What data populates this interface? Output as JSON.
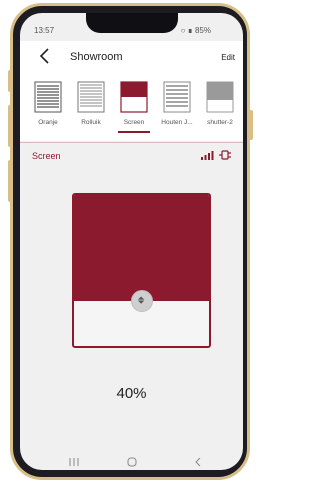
{
  "status": {
    "time": "13:57",
    "battery": "85%"
  },
  "header": {
    "title": "Showroom",
    "edit_label": "Edit"
  },
  "tabs": [
    {
      "label": "Oranje",
      "icon": "horizontal-blinds-icon",
      "active": false
    },
    {
      "label": "Rolluik",
      "icon": "roller-shutter-icon",
      "active": false
    },
    {
      "label": "Screen",
      "icon": "screen-shade-icon",
      "active": true
    },
    {
      "label": "Houten J...",
      "icon": "wooden-blinds-icon",
      "active": false
    },
    {
      "label": "shutter-2",
      "icon": "shutter-icon",
      "active": false
    }
  ],
  "device": {
    "name": "Screen",
    "signal_icon": "signal-bars-icon",
    "power_icon": "plug-icon"
  },
  "shade": {
    "position_percent": 40,
    "position_label": "40%",
    "handle_icon": "up-down-arrows-icon"
  },
  "colors": {
    "accent": "#8b1a2f",
    "background": "#f1f0f0",
    "frame_gold": "#d8bf87"
  },
  "navbar": {
    "items": [
      "recents-icon",
      "home-icon",
      "back-icon"
    ]
  }
}
